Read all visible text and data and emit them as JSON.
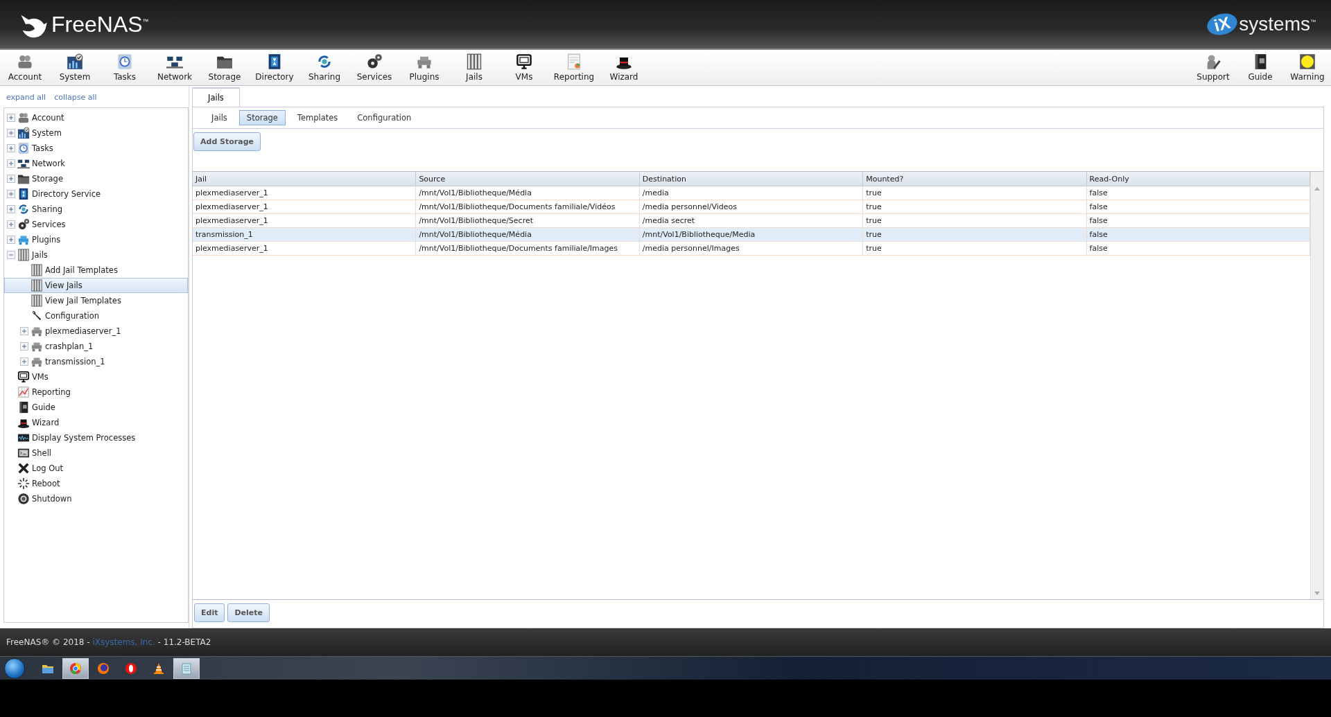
{
  "header": {
    "logo_text": "FreeNAS$^{™}$",
    "brand_badge": "iX",
    "brand_text": "systems$^{™}$"
  },
  "toolbar": {
    "left": [
      {
        "label": "Account"
      },
      {
        "label": "System"
      },
      {
        "label": "Tasks"
      },
      {
        "label": "Network"
      },
      {
        "label": "Storage"
      },
      {
        "label": "Directory"
      },
      {
        "label": "Sharing"
      },
      {
        "label": "Services"
      },
      {
        "label": "Plugins"
      },
      {
        "label": "Jails"
      },
      {
        "label": "VMs"
      },
      {
        "label": "Reporting"
      },
      {
        "label": "Wizard"
      }
    ],
    "right": [
      {
        "label": "Support"
      },
      {
        "label": "Guide"
      },
      {
        "label": "Warning"
      }
    ]
  },
  "sidebar": {
    "links": [
      "expand all",
      "collapse all"
    ],
    "tree": [
      {
        "label": "Account",
        "expanded": false,
        "selected": false
      },
      {
        "label": "System",
        "expanded": false,
        "selected": false
      },
      {
        "label": "Tasks",
        "expanded": false,
        "selected": false
      },
      {
        "label": "Network",
        "expanded": false,
        "selected": false
      },
      {
        "label": "Storage",
        "expanded": false,
        "selected": false
      },
      {
        "label": "Directory Service",
        "expanded": false,
        "selected": false
      },
      {
        "label": "Sharing",
        "expanded": false,
        "selected": false
      },
      {
        "label": "Services",
        "expanded": false,
        "selected": false
      },
      {
        "label": "Plugins",
        "expanded": false,
        "selected": false
      },
      {
        "label": "Jails",
        "expanded": true,
        "selected": false,
        "children": [
          {
            "label": "Add Jail Templates",
            "selected": false
          },
          {
            "label": "View Jails",
            "selected": true
          },
          {
            "label": "View Jail Templates",
            "selected": false
          },
          {
            "label": "Configuration",
            "selected": false
          },
          {
            "label": "plexmediaserver_1",
            "expanded": false,
            "selected": false
          },
          {
            "label": "crashplan_1",
            "expanded": false,
            "selected": false
          },
          {
            "label": "transmission_1",
            "expanded": false,
            "selected": false
          }
        ]
      },
      {
        "label": "VMs",
        "selected": false
      },
      {
        "label": "Reporting",
        "selected": false
      },
      {
        "label": "Guide",
        "selected": false
      },
      {
        "label": "Wizard",
        "selected": false
      },
      {
        "label": "Display System Processes",
        "selected": false
      },
      {
        "label": "Shell",
        "selected": false
      },
      {
        "label": "Log Out",
        "selected": false
      },
      {
        "label": "Reboot",
        "selected": false
      },
      {
        "label": "Shutdown",
        "selected": false
      }
    ]
  },
  "tabs": [
    {
      "label": "Jails",
      "selected": true
    }
  ],
  "subtabs": [
    {
      "label": "Jails",
      "selected": false
    },
    {
      "label": "Storage",
      "selected": true
    },
    {
      "label": "Templates",
      "selected": false
    },
    {
      "label": "Configuration",
      "selected": false
    }
  ],
  "add_button": "Add Storage",
  "table": {
    "columns": [
      "Jail",
      "Source",
      "Destination",
      "Mounted?",
      "Read-Only"
    ],
    "rows": [
      {
        "cells": [
          "plexmediaserver_1",
          "/mnt/Vol1/Bibliotheque/Média",
          "/media",
          "true",
          "false"
        ],
        "selected": false
      },
      {
        "cells": [
          "plexmediaserver_1",
          "/mnt/Vol1/Bibliotheque/Documents familiale/Vidéos",
          "/media personnel/Videos",
          "true",
          "false"
        ],
        "selected": false
      },
      {
        "cells": [
          "plexmediaserver_1",
          "/mnt/Vol1/Bibliotheque/Secret",
          "/media secret",
          "true",
          "false"
        ],
        "selected": false
      },
      {
        "cells": [
          "transmission_1",
          "/mnt/Vol1/Bibliotheque/Média",
          "/mnt/Vol1/Bibliotheque/Media",
          "true",
          "false"
        ],
        "selected": true
      },
      {
        "cells": [
          "plexmediaserver_1",
          "/mnt/Vol1/Bibliotheque/Documents familiale/Images",
          "/media personnel/Images",
          "true",
          "false"
        ],
        "selected": false
      }
    ]
  },
  "actions": [
    "Edit",
    "Delete"
  ],
  "footer": {
    "text_before": "FreeNAS® © 2018 - ",
    "link": "iXsystems, Inc.",
    "text_after": " - 11.2-BETA2"
  },
  "taskbar": {
    "apps": [
      {
        "running": false
      },
      {
        "running": true
      },
      {
        "running": false
      },
      {
        "running": false
      },
      {
        "running": false
      },
      {
        "running": true
      }
    ]
  }
}
